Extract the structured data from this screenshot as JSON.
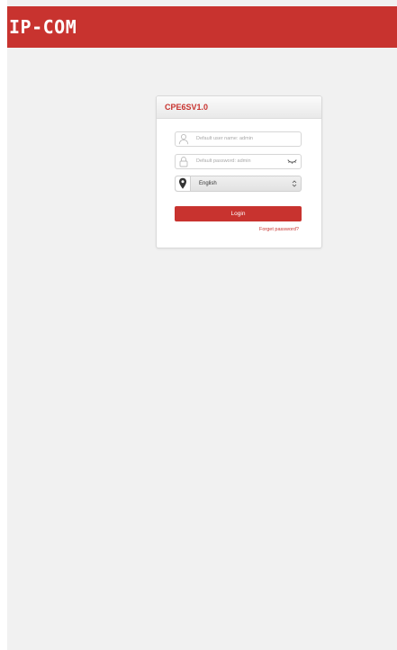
{
  "brand": {
    "logo_text": "IP-COM",
    "accent_color": "#c8332f"
  },
  "login": {
    "title": "CPE6SV1.0",
    "username": {
      "placeholder": "Default user name: admin",
      "icon": "user-icon"
    },
    "password": {
      "placeholder": "Default password: admin",
      "icon": "lock-icon",
      "toggle_icon": "eye-closed-icon"
    },
    "language": {
      "selected": "English",
      "icon": "location-pin-icon"
    },
    "login_label": "Login",
    "forget_password_label": "Forget password?"
  }
}
